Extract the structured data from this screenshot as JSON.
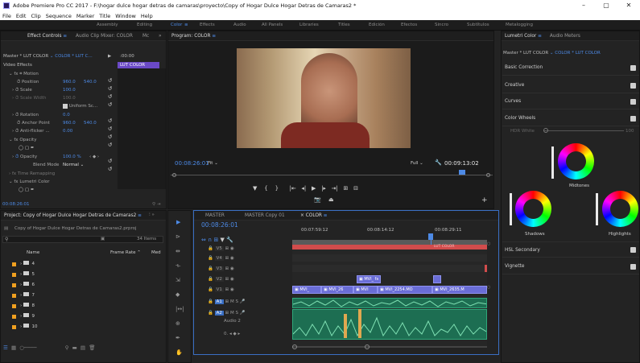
{
  "window": {
    "title": "Adobe Premiere Pro CC 2017 - F:\\hogar dulce hogar detras de camaras\\proyecto\\Copy of Hogar Dulce Hogar Detras de Camaras2 *",
    "minimize": "–",
    "maximize": "▢",
    "close": "✕"
  },
  "menu": [
    "File",
    "Edit",
    "Clip",
    "Sequence",
    "Marker",
    "Title",
    "Window",
    "Help"
  ],
  "workspaces": [
    "Assembly",
    "Editing",
    "Color",
    "Effects",
    "Audio",
    "All Panels",
    "Libraries",
    "Titles",
    "Edición",
    "Efectos",
    "Sincro",
    "Subtítulos",
    "Metalogging"
  ],
  "effect_controls": {
    "tabs": [
      "Effect Controls",
      "Audio Clip Mixer: COLOR",
      "Mc"
    ],
    "master": "Master * LUT COLOR",
    "clip": "COLOR * LUT C...",
    "time": ":00:00",
    "clip_label": "LUT COLOR",
    "video_effects": "Video Effects",
    "motion": "Motion",
    "position": "Position",
    "position_x": "960.0",
    "position_y": "540.0",
    "scale": "Scale",
    "scale_val": "100.0",
    "scale_width": "Scale Width",
    "scale_width_val": "100.0",
    "uniform": "Uniform Sc...",
    "rotation": "Rotation",
    "rotation_val": "0.0",
    "anchor": "Anchor Point",
    "anchor_x": "960.0",
    "anchor_y": "540.0",
    "antiflicker": "Anti-flicker ...",
    "antiflicker_val": "0.00",
    "opacity_group": "Opacity",
    "opacity": "Opacity",
    "opacity_val": "100.0 %",
    "blend": "Blend Mode",
    "blend_val": "Normal",
    "time_remap": "Time Remapping",
    "lumetri": "Lumetri Color",
    "timecode": "00:08:26:01"
  },
  "program": {
    "tab": "Program: COLOR",
    "timecode": "00:08:26:01",
    "fit": "Fit",
    "quality": "Full",
    "duration": "00:09:13:02"
  },
  "lumetri": {
    "tabs": [
      "Lumetri Color",
      "Audio Meters"
    ],
    "master": "Master * LUT COLOR",
    "clip": "COLOR * LUT COLOR",
    "sections": [
      "Basic Correction",
      "Creative",
      "Curves",
      "Color Wheels"
    ],
    "hdr": "HDR White",
    "hdr_val": "100",
    "midtones": "Midtones",
    "shadows": "Shadows",
    "highlights": "Highlights",
    "hsl": "HSL Secondary",
    "vignette": "Vignette"
  },
  "project": {
    "tab": "Project: Copy of Hogar Dulce Hogar Detras de Camaras2",
    "file": "Copy of Hogar Dulce Hogar Detras de Camaras2.prproj",
    "count": "34 Items",
    "col_name": "Name",
    "col_rate": "Frame Rate",
    "col_med": "Med",
    "items": [
      "4",
      "5",
      "6",
      "7",
      "8",
      "9",
      "10"
    ]
  },
  "timeline": {
    "tabs": [
      "MASTER",
      "MASTER Copy 01",
      "COLOR"
    ],
    "timecode": "00:08:26:01",
    "ruler": [
      "00:07:59:12",
      "00:08:14:12",
      "00:08:29:11"
    ],
    "video_tracks": [
      "V5",
      "V4",
      "V3",
      "V2",
      "V1"
    ],
    "audio_tracks": [
      "A1",
      "A2"
    ],
    "a2_name": "Audio 2",
    "a2_vol": "0.",
    "track_m": "M",
    "track_s": "S",
    "clips_v1": [
      "MVI_",
      "MVI_26",
      "MVI",
      "MVI_2254.MO",
      "MVI_2635.M"
    ],
    "clip_v2": "MVI_",
    "clip_v4": "fx",
    "clip_v5": "LUT COLOR"
  }
}
